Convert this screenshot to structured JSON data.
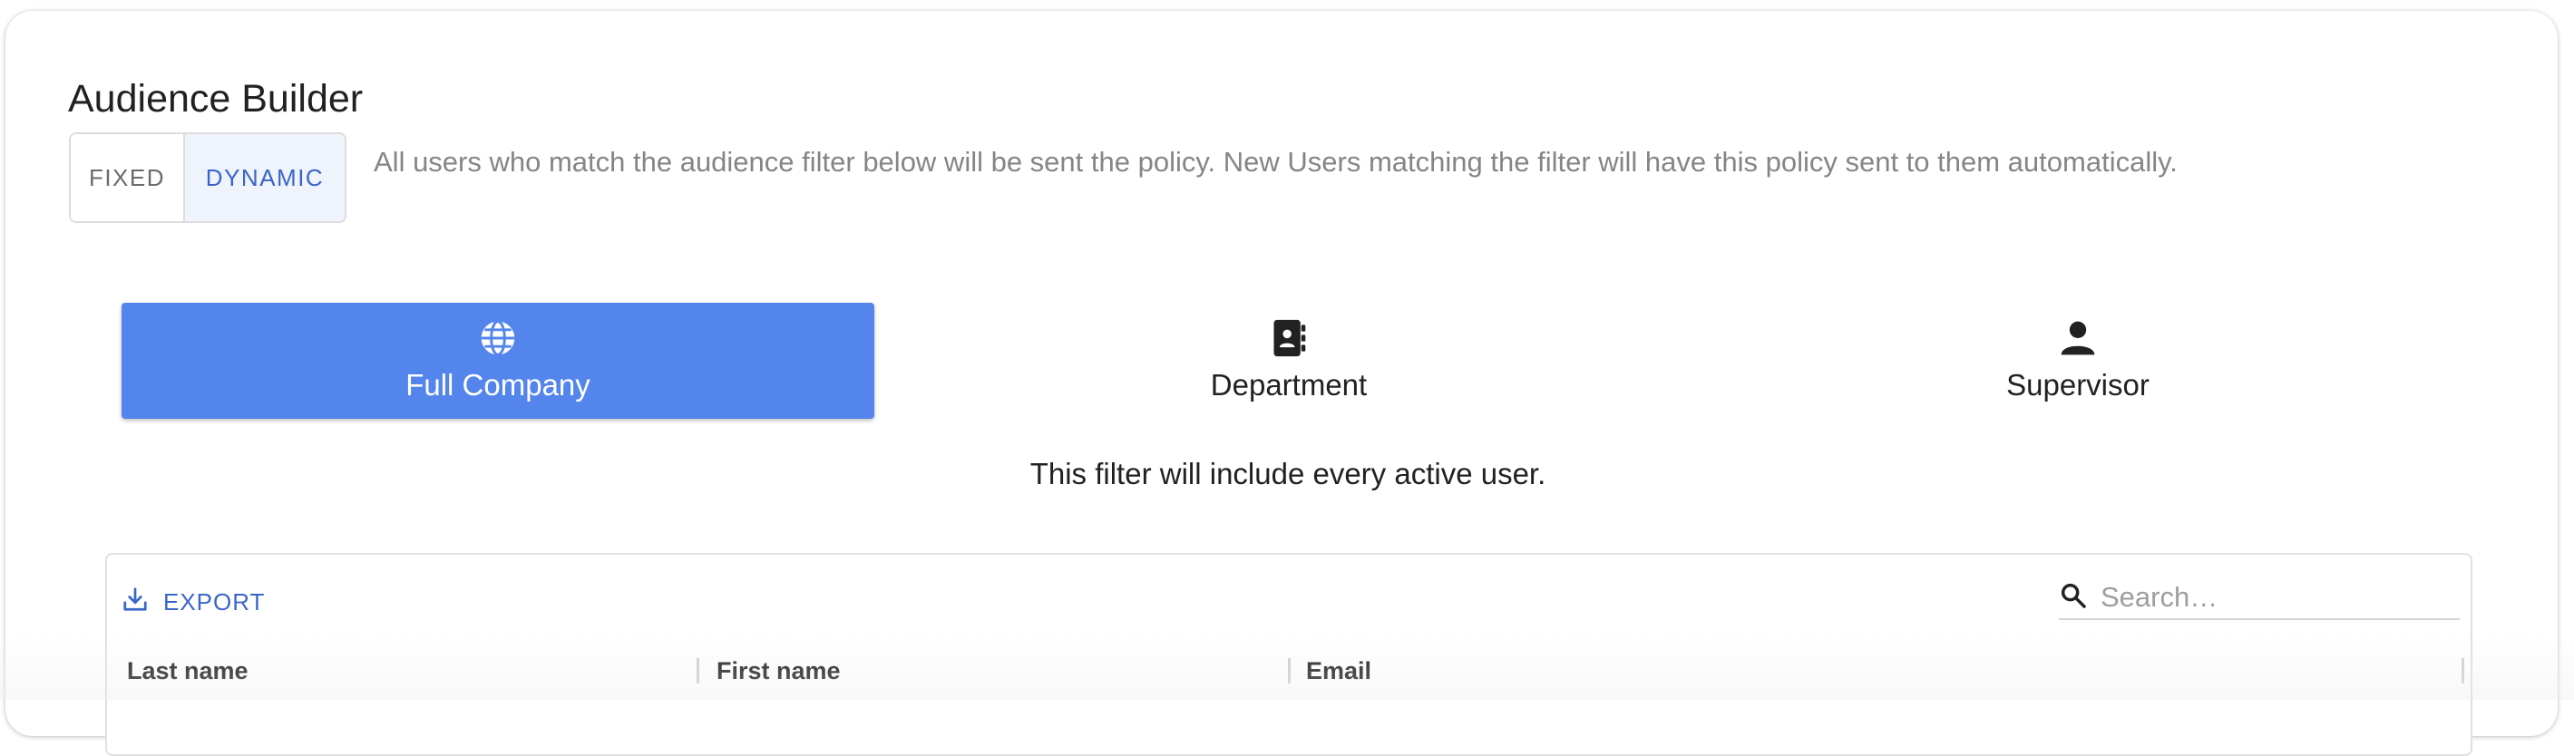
{
  "header": {
    "title": "Audience Builder"
  },
  "mode_toggle": {
    "options": [
      {
        "label": "FIXED",
        "selected": false
      },
      {
        "label": "DYNAMIC",
        "selected": true
      }
    ],
    "description": "All users who match the audience filter below will be sent the policy. New Users matching the filter will have this policy sent to them automatically."
  },
  "filter_tabs": {
    "items": [
      {
        "label": "Full Company",
        "icon": "globe-icon",
        "selected": true
      },
      {
        "label": "Department",
        "icon": "contact-book-icon",
        "selected": false
      },
      {
        "label": "Supervisor",
        "icon": "person-icon",
        "selected": false
      }
    ],
    "note": "This filter will include every active user."
  },
  "grid": {
    "export_label": "EXPORT",
    "search": {
      "placeholder": "Search…",
      "value": ""
    },
    "columns": [
      "Last name",
      "First name",
      "Email"
    ]
  },
  "colors": {
    "accent": "#5485ec",
    "link": "#3a66c9",
    "selected_toggle_bg": "#eef3fc",
    "muted_text": "#858585"
  }
}
